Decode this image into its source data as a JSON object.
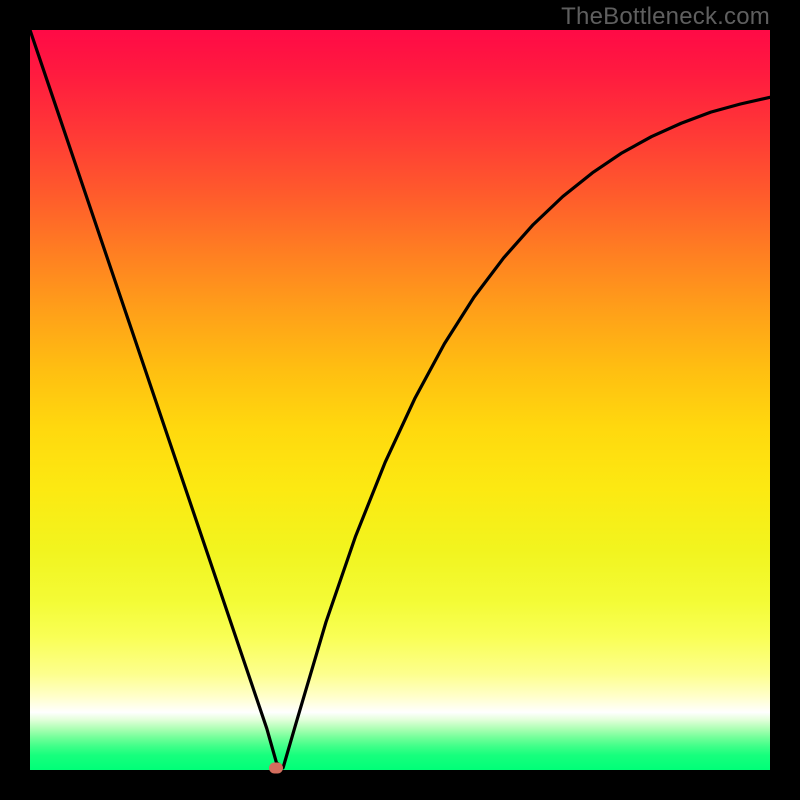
{
  "brand": "TheBottleneck.com",
  "chart_data": {
    "type": "line",
    "title": "",
    "xlabel": "",
    "ylabel": "",
    "xlim": [
      0,
      100
    ],
    "ylim": [
      0,
      100
    ],
    "x": [
      0,
      4,
      8,
      12,
      16,
      20,
      24,
      28,
      30,
      32,
      33.3,
      34.2,
      36,
      40,
      44,
      48,
      52,
      56,
      60,
      64,
      68,
      72,
      76,
      80,
      84,
      88,
      92,
      96,
      100
    ],
    "values": [
      100,
      88.2,
      76.4,
      64.6,
      52.8,
      41.0,
      29.2,
      17.4,
      11.5,
      5.6,
      1.0,
      0.3,
      6.5,
      20.0,
      31.6,
      41.6,
      50.2,
      57.6,
      63.9,
      69.2,
      73.7,
      77.5,
      80.7,
      83.4,
      85.6,
      87.4,
      88.9,
      90.0,
      90.9
    ],
    "min_point": {
      "x": 33.3,
      "y": 0.3
    },
    "annotations": []
  },
  "colors": {
    "frame": "#000000",
    "brand_text": "#5f5f5f",
    "curve": "#000000",
    "min_dot": "#d36e5e"
  }
}
